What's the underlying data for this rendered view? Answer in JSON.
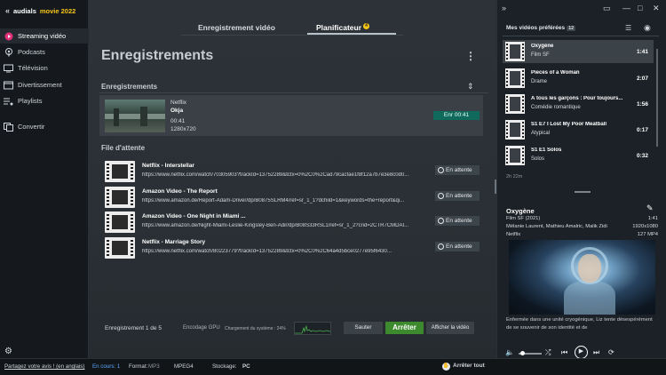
{
  "app": {
    "name": "audials",
    "product": "movie 2022"
  },
  "sidebar": {
    "items": [
      {
        "label": "Streaming vidéo",
        "icon": "streaming-icon"
      },
      {
        "label": "Podcasts",
        "icon": "podcast-icon"
      },
      {
        "label": "Télévision",
        "icon": "tv-icon"
      },
      {
        "label": "Divertissement",
        "icon": "entertainment-icon"
      },
      {
        "label": "Playlists",
        "icon": "playlist-icon"
      },
      {
        "label": "Convertir",
        "icon": "convert-icon"
      }
    ]
  },
  "tabs": [
    {
      "label": "Enregistrement vidéo"
    },
    {
      "label": "Planificateur",
      "badge": "4"
    }
  ],
  "main": {
    "title": "Enregistrements",
    "recordings_header": "Enregistrements",
    "current": {
      "service": "Netflix",
      "title": "Okja",
      "time": "00:41",
      "resolution": "1280x720",
      "status": "Enr 00:41"
    },
    "queue_header": "File d'attente",
    "queue": [
      {
        "title": "Netflix - Interstellar",
        "url": "https://www.netflix.com/watch/70305903?trackId=13752289&tctx=0%2C0%2Cad79cacfae1f8f12a7b7e3e8c0d0...",
        "status": "En attente"
      },
      {
        "title": "Amazon Video - The Report",
        "url": "https://www.amazon.de/Report-Adam-Driver/dp/B0875SLRM4/ref=sr_1_1?dchild=1&keywords=the+report&qi...",
        "status": "En attente"
      },
      {
        "title": "Amazon Video - One Night in Miami ...",
        "url": "https://www.amazon.de/Night-Miami-Leslie-Kingsley-Ben-Adir/dp/B08S33RSL1/ref=sr_1_2?crid=2CTR7CMDAI...",
        "status": "En attente"
      },
      {
        "title": "Netflix - Marriage Story",
        "url": "https://www.netflix.com/watch/80223779?trackId=13752289&tctx=0%2C0%2C64a4d5bce0277e95f6430...",
        "status": "En attente"
      }
    ],
    "footer": {
      "counter": "Enregistrement 1 de 5",
      "gpu": "Encodage GPU",
      "load": "Chargement du système : 24%",
      "skip": "Sauter",
      "stop": "Arrêter",
      "show_video": "Afficher la vidéo"
    }
  },
  "right": {
    "favorites_header": "Mes vidéos préférées",
    "favorites_count": "12",
    "favorites": [
      {
        "title": "Oxygène",
        "genre": "Film SF",
        "duration": "1:41",
        "active": true
      },
      {
        "title": "Pieces of a Woman",
        "genre": "Drame",
        "duration": "2:07"
      },
      {
        "title": "À tous les garçons : Pour toujours...",
        "genre": "Comédie romantique",
        "duration": "1:56"
      },
      {
        "title": "S1 E7 I Lost My Poor Meatball",
        "genre": "Atypical",
        "duration": "0:17"
      },
      {
        "title": "S1 E1 Solos",
        "genre": "Solos",
        "duration": "0:32"
      }
    ],
    "total": "2h 22m",
    "detail": {
      "title": "Oxygène",
      "year": "Film SF (2021)",
      "cast": "Mélanie Laurent, Mathieu Amalric, Malik Zidi",
      "service": "Netflix",
      "duration": "1:41",
      "resolution": "1920x1080",
      "size": "127 MP4",
      "synopsis": "Enfermée dans une unité cryogénique, Liz tente désespérément de se souvenir de son identité et de"
    }
  },
  "statusbar": {
    "feedback": "Partagez votre avis ! (en anglais)",
    "running": "En cours: 1",
    "format_label": "Format:",
    "mp3": "MP3",
    "mpeg4": "MPEG4",
    "storage_label": "Stockage:",
    "pc": "PC",
    "stop_all": "Arrêter tout"
  }
}
